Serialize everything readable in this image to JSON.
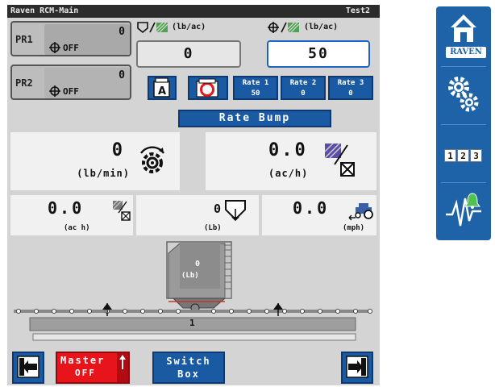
{
  "titlebar": {
    "app": "Raven RCM-Main",
    "profile": "Test2"
  },
  "products": [
    {
      "label": "PR1",
      "count": "0",
      "status": "OFF"
    },
    {
      "label": "PR2",
      "count": "0",
      "status": "OFF"
    }
  ],
  "rates": {
    "actual_unit": "(lb/ac)",
    "target_unit": "(lb/ac)",
    "actual_value": "0",
    "target_value": "50"
  },
  "rate_presets": [
    {
      "name": "Rate 1",
      "value": "50"
    },
    {
      "name": "Rate 2",
      "value": "0"
    },
    {
      "name": "Rate 3",
      "value": "0"
    }
  ],
  "rate_bump_label": "Rate Bump",
  "flow": {
    "value": "0",
    "unit": "(lb/min)"
  },
  "area_rate": {
    "value": "0.0",
    "unit": "(ac/h)"
  },
  "area": {
    "value": "0.0",
    "unit": "(ac h)"
  },
  "volume": {
    "value": "0",
    "unit": "(Lb)"
  },
  "speed": {
    "value": "0.0",
    "unit": "(mph)"
  },
  "tank": {
    "value": "0",
    "unit": "(Lb)"
  },
  "section": {
    "number": "1"
  },
  "master": {
    "label": "Master",
    "state": "OFF"
  },
  "switch_box": {
    "line1": "Switch",
    "line2": "Box"
  },
  "sidebar": {
    "brand": "RAVEN",
    "numpad": [
      "1",
      "2",
      "3"
    ]
  },
  "colors": {
    "accent": "#1a5aa3",
    "sidebar": "#1e62a8",
    "master": "#e8141c",
    "panel": "#d4d4d4"
  },
  "icons": [
    "home-icon",
    "gears-icon",
    "numpad-icon",
    "alarm-icon",
    "auto-mode-icon",
    "manual-rate-icon",
    "rate-control-icon",
    "area-icon",
    "volume-icon",
    "speed-icon",
    "nav-left-icon",
    "nav-right-icon",
    "target-icon"
  ]
}
